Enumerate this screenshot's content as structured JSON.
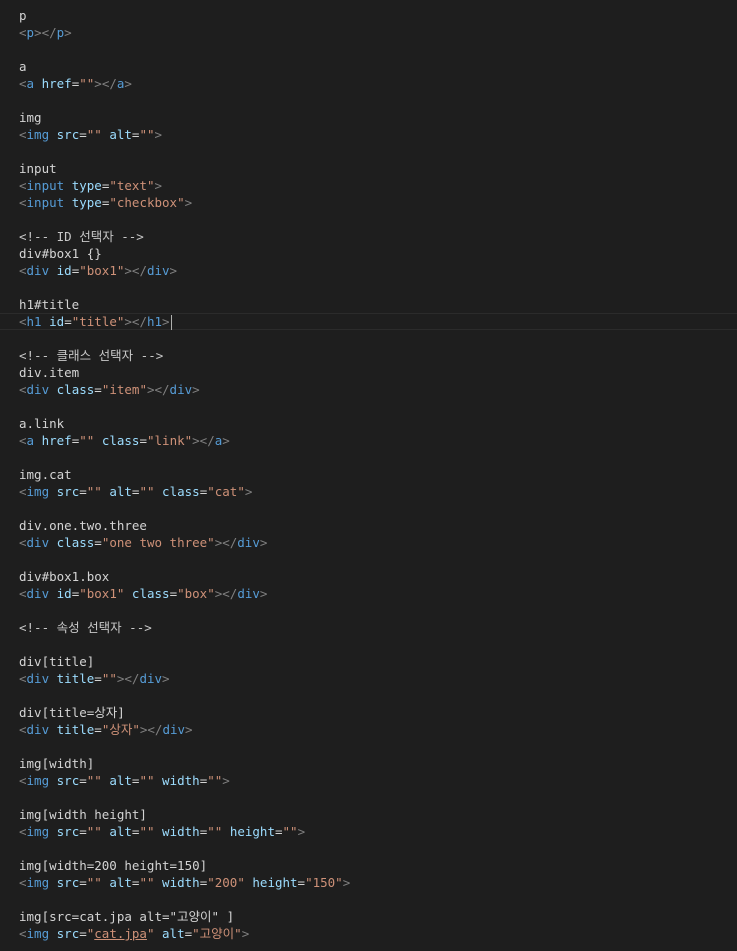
{
  "lines": [
    {
      "row": 0,
      "tokens": [
        {
          "t": "p",
          "c": "plain"
        }
      ]
    },
    {
      "row": 1,
      "tokens": [
        {
          "t": "<",
          "c": "punct"
        },
        {
          "t": "p",
          "c": "tag"
        },
        {
          "t": "></",
          "c": "punct"
        },
        {
          "t": "p",
          "c": "tag"
        },
        {
          "t": ">",
          "c": "punct"
        }
      ]
    },
    {
      "row": 3,
      "tokens": [
        {
          "t": "a",
          "c": "plain"
        }
      ]
    },
    {
      "row": 4,
      "tokens": [
        {
          "t": "<",
          "c": "punct"
        },
        {
          "t": "a",
          "c": "tag"
        },
        {
          "t": " ",
          "c": "plain"
        },
        {
          "t": "href",
          "c": "attr"
        },
        {
          "t": "=",
          "c": "op"
        },
        {
          "t": "\"\"",
          "c": "str"
        },
        {
          "t": "></",
          "c": "punct"
        },
        {
          "t": "a",
          "c": "tag"
        },
        {
          "t": ">",
          "c": "punct"
        }
      ]
    },
    {
      "row": 6,
      "tokens": [
        {
          "t": "img",
          "c": "plain"
        }
      ]
    },
    {
      "row": 7,
      "tokens": [
        {
          "t": "<",
          "c": "punct"
        },
        {
          "t": "img",
          "c": "tag"
        },
        {
          "t": " ",
          "c": "plain"
        },
        {
          "t": "src",
          "c": "attr"
        },
        {
          "t": "=",
          "c": "op"
        },
        {
          "t": "\"\"",
          "c": "str"
        },
        {
          "t": " ",
          "c": "plain"
        },
        {
          "t": "alt",
          "c": "attr"
        },
        {
          "t": "=",
          "c": "op"
        },
        {
          "t": "\"\"",
          "c": "str"
        },
        {
          "t": ">",
          "c": "punct"
        }
      ]
    },
    {
      "row": 9,
      "tokens": [
        {
          "t": "input",
          "c": "plain"
        }
      ]
    },
    {
      "row": 10,
      "tokens": [
        {
          "t": "<",
          "c": "punct"
        },
        {
          "t": "input",
          "c": "tag"
        },
        {
          "t": " ",
          "c": "plain"
        },
        {
          "t": "type",
          "c": "attr"
        },
        {
          "t": "=",
          "c": "op"
        },
        {
          "t": "\"text\"",
          "c": "str"
        },
        {
          "t": ">",
          "c": "punct"
        }
      ]
    },
    {
      "row": 11,
      "tokens": [
        {
          "t": "<",
          "c": "punct"
        },
        {
          "t": "input",
          "c": "tag"
        },
        {
          "t": " ",
          "c": "plain"
        },
        {
          "t": "type",
          "c": "attr"
        },
        {
          "t": "=",
          "c": "op"
        },
        {
          "t": "\"checkbox\"",
          "c": "str"
        },
        {
          "t": ">",
          "c": "punct"
        }
      ]
    },
    {
      "row": 13,
      "tokens": [
        {
          "t": "<!-- ID 선택자 -->",
          "c": "comment"
        }
      ]
    },
    {
      "row": 14,
      "tokens": [
        {
          "t": "div#box1 {}",
          "c": "plain"
        }
      ]
    },
    {
      "row": 15,
      "tokens": [
        {
          "t": "<",
          "c": "punct"
        },
        {
          "t": "div",
          "c": "tag"
        },
        {
          "t": " ",
          "c": "plain"
        },
        {
          "t": "id",
          "c": "attr"
        },
        {
          "t": "=",
          "c": "op"
        },
        {
          "t": "\"box1\"",
          "c": "str"
        },
        {
          "t": "></",
          "c": "punct"
        },
        {
          "t": "div",
          "c": "tag"
        },
        {
          "t": ">",
          "c": "punct"
        }
      ]
    },
    {
      "row": 17,
      "tokens": [
        {
          "t": "h1#title",
          "c": "plain"
        }
      ]
    },
    {
      "row": 18,
      "active": true,
      "cursor": true,
      "tokens": [
        {
          "t": "<",
          "c": "punct"
        },
        {
          "t": "h1",
          "c": "tag"
        },
        {
          "t": " ",
          "c": "plain"
        },
        {
          "t": "id",
          "c": "attr"
        },
        {
          "t": "=",
          "c": "op"
        },
        {
          "t": "\"title\"",
          "c": "str"
        },
        {
          "t": "></",
          "c": "punct"
        },
        {
          "t": "h1",
          "c": "tag"
        },
        {
          "t": ">",
          "c": "punct"
        }
      ]
    },
    {
      "row": 20,
      "tokens": [
        {
          "t": "<!-- 클래스 선택자 -->",
          "c": "comment"
        }
      ]
    },
    {
      "row": 21,
      "tokens": [
        {
          "t": "div.item",
          "c": "plain"
        }
      ]
    },
    {
      "row": 22,
      "tokens": [
        {
          "t": "<",
          "c": "punct"
        },
        {
          "t": "div",
          "c": "tag"
        },
        {
          "t": " ",
          "c": "plain"
        },
        {
          "t": "class",
          "c": "attr"
        },
        {
          "t": "=",
          "c": "op"
        },
        {
          "t": "\"item\"",
          "c": "str"
        },
        {
          "t": "></",
          "c": "punct"
        },
        {
          "t": "div",
          "c": "tag"
        },
        {
          "t": ">",
          "c": "punct"
        }
      ]
    },
    {
      "row": 24,
      "tokens": [
        {
          "t": "a.link",
          "c": "plain"
        }
      ]
    },
    {
      "row": 25,
      "tokens": [
        {
          "t": "<",
          "c": "punct"
        },
        {
          "t": "a",
          "c": "tag"
        },
        {
          "t": " ",
          "c": "plain"
        },
        {
          "t": "href",
          "c": "attr"
        },
        {
          "t": "=",
          "c": "op"
        },
        {
          "t": "\"\"",
          "c": "str"
        },
        {
          "t": " ",
          "c": "plain"
        },
        {
          "t": "class",
          "c": "attr"
        },
        {
          "t": "=",
          "c": "op"
        },
        {
          "t": "\"link\"",
          "c": "str"
        },
        {
          "t": "></",
          "c": "punct"
        },
        {
          "t": "a",
          "c": "tag"
        },
        {
          "t": ">",
          "c": "punct"
        }
      ]
    },
    {
      "row": 27,
      "tokens": [
        {
          "t": "img.cat",
          "c": "plain"
        }
      ]
    },
    {
      "row": 28,
      "tokens": [
        {
          "t": "<",
          "c": "punct"
        },
        {
          "t": "img",
          "c": "tag"
        },
        {
          "t": " ",
          "c": "plain"
        },
        {
          "t": "src",
          "c": "attr"
        },
        {
          "t": "=",
          "c": "op"
        },
        {
          "t": "\"\"",
          "c": "str"
        },
        {
          "t": " ",
          "c": "plain"
        },
        {
          "t": "alt",
          "c": "attr"
        },
        {
          "t": "=",
          "c": "op"
        },
        {
          "t": "\"\"",
          "c": "str"
        },
        {
          "t": " ",
          "c": "plain"
        },
        {
          "t": "class",
          "c": "attr"
        },
        {
          "t": "=",
          "c": "op"
        },
        {
          "t": "\"cat\"",
          "c": "str"
        },
        {
          "t": ">",
          "c": "punct"
        }
      ]
    },
    {
      "row": 30,
      "tokens": [
        {
          "t": "div.one.two.three",
          "c": "plain"
        }
      ]
    },
    {
      "row": 31,
      "tokens": [
        {
          "t": "<",
          "c": "punct"
        },
        {
          "t": "div",
          "c": "tag"
        },
        {
          "t": " ",
          "c": "plain"
        },
        {
          "t": "class",
          "c": "attr"
        },
        {
          "t": "=",
          "c": "op"
        },
        {
          "t": "\"one two three\"",
          "c": "str"
        },
        {
          "t": "></",
          "c": "punct"
        },
        {
          "t": "div",
          "c": "tag"
        },
        {
          "t": ">",
          "c": "punct"
        }
      ]
    },
    {
      "row": 33,
      "tokens": [
        {
          "t": "div#box1.box",
          "c": "plain"
        }
      ]
    },
    {
      "row": 34,
      "tokens": [
        {
          "t": "<",
          "c": "punct"
        },
        {
          "t": "div",
          "c": "tag"
        },
        {
          "t": " ",
          "c": "plain"
        },
        {
          "t": "id",
          "c": "attr"
        },
        {
          "t": "=",
          "c": "op"
        },
        {
          "t": "\"box1\"",
          "c": "str"
        },
        {
          "t": " ",
          "c": "plain"
        },
        {
          "t": "class",
          "c": "attr"
        },
        {
          "t": "=",
          "c": "op"
        },
        {
          "t": "\"box\"",
          "c": "str"
        },
        {
          "t": "></",
          "c": "punct"
        },
        {
          "t": "div",
          "c": "tag"
        },
        {
          "t": ">",
          "c": "punct"
        }
      ]
    },
    {
      "row": 36,
      "tokens": [
        {
          "t": "<!-- 속성 선택자 -->",
          "c": "comment"
        }
      ]
    },
    {
      "row": 38,
      "tokens": [
        {
          "t": "div[title]",
          "c": "plain"
        }
      ]
    },
    {
      "row": 39,
      "tokens": [
        {
          "t": "<",
          "c": "punct"
        },
        {
          "t": "div",
          "c": "tag"
        },
        {
          "t": " ",
          "c": "plain"
        },
        {
          "t": "title",
          "c": "attr"
        },
        {
          "t": "=",
          "c": "op"
        },
        {
          "t": "\"\"",
          "c": "str"
        },
        {
          "t": "></",
          "c": "punct"
        },
        {
          "t": "div",
          "c": "tag"
        },
        {
          "t": ">",
          "c": "punct"
        }
      ]
    },
    {
      "row": 41,
      "tokens": [
        {
          "t": "div[title=상자]",
          "c": "plain"
        }
      ]
    },
    {
      "row": 42,
      "tokens": [
        {
          "t": "<",
          "c": "punct"
        },
        {
          "t": "div",
          "c": "tag"
        },
        {
          "t": " ",
          "c": "plain"
        },
        {
          "t": "title",
          "c": "attr"
        },
        {
          "t": "=",
          "c": "op"
        },
        {
          "t": "\"상자\"",
          "c": "str"
        },
        {
          "t": "></",
          "c": "punct"
        },
        {
          "t": "div",
          "c": "tag"
        },
        {
          "t": ">",
          "c": "punct"
        }
      ]
    },
    {
      "row": 44,
      "tokens": [
        {
          "t": "img[width]",
          "c": "plain"
        }
      ]
    },
    {
      "row": 45,
      "tokens": [
        {
          "t": "<",
          "c": "punct"
        },
        {
          "t": "img",
          "c": "tag"
        },
        {
          "t": " ",
          "c": "plain"
        },
        {
          "t": "src",
          "c": "attr"
        },
        {
          "t": "=",
          "c": "op"
        },
        {
          "t": "\"\"",
          "c": "str"
        },
        {
          "t": " ",
          "c": "plain"
        },
        {
          "t": "alt",
          "c": "attr"
        },
        {
          "t": "=",
          "c": "op"
        },
        {
          "t": "\"\"",
          "c": "str"
        },
        {
          "t": " ",
          "c": "plain"
        },
        {
          "t": "width",
          "c": "attr"
        },
        {
          "t": "=",
          "c": "op"
        },
        {
          "t": "\"\"",
          "c": "str"
        },
        {
          "t": ">",
          "c": "punct"
        }
      ]
    },
    {
      "row": 47,
      "tokens": [
        {
          "t": "img[width height]",
          "c": "plain"
        }
      ]
    },
    {
      "row": 48,
      "tokens": [
        {
          "t": "<",
          "c": "punct"
        },
        {
          "t": "img",
          "c": "tag"
        },
        {
          "t": " ",
          "c": "plain"
        },
        {
          "t": "src",
          "c": "attr"
        },
        {
          "t": "=",
          "c": "op"
        },
        {
          "t": "\"\"",
          "c": "str"
        },
        {
          "t": " ",
          "c": "plain"
        },
        {
          "t": "alt",
          "c": "attr"
        },
        {
          "t": "=",
          "c": "op"
        },
        {
          "t": "\"\"",
          "c": "str"
        },
        {
          "t": " ",
          "c": "plain"
        },
        {
          "t": "width",
          "c": "attr"
        },
        {
          "t": "=",
          "c": "op"
        },
        {
          "t": "\"\"",
          "c": "str"
        },
        {
          "t": " ",
          "c": "plain"
        },
        {
          "t": "height",
          "c": "attr"
        },
        {
          "t": "=",
          "c": "op"
        },
        {
          "t": "\"\"",
          "c": "str"
        },
        {
          "t": ">",
          "c": "punct"
        }
      ]
    },
    {
      "row": 50,
      "tokens": [
        {
          "t": "img[width=200 height=150]",
          "c": "plain"
        }
      ]
    },
    {
      "row": 51,
      "tokens": [
        {
          "t": "<",
          "c": "punct"
        },
        {
          "t": "img",
          "c": "tag"
        },
        {
          "t": " ",
          "c": "plain"
        },
        {
          "t": "src",
          "c": "attr"
        },
        {
          "t": "=",
          "c": "op"
        },
        {
          "t": "\"\"",
          "c": "str"
        },
        {
          "t": " ",
          "c": "plain"
        },
        {
          "t": "alt",
          "c": "attr"
        },
        {
          "t": "=",
          "c": "op"
        },
        {
          "t": "\"\"",
          "c": "str"
        },
        {
          "t": " ",
          "c": "plain"
        },
        {
          "t": "width",
          "c": "attr"
        },
        {
          "t": "=",
          "c": "op"
        },
        {
          "t": "\"200\"",
          "c": "str"
        },
        {
          "t": " ",
          "c": "plain"
        },
        {
          "t": "height",
          "c": "attr"
        },
        {
          "t": "=",
          "c": "op"
        },
        {
          "t": "\"150\"",
          "c": "str"
        },
        {
          "t": ">",
          "c": "punct"
        }
      ]
    },
    {
      "row": 53,
      "tokens": [
        {
          "t": "img[src=cat.jpa alt=\"고양이\" ]",
          "c": "plain"
        }
      ]
    },
    {
      "row": 54,
      "tokens": [
        {
          "t": "<",
          "c": "punct"
        },
        {
          "t": "img",
          "c": "tag"
        },
        {
          "t": " ",
          "c": "plain"
        },
        {
          "t": "src",
          "c": "attr"
        },
        {
          "t": "=",
          "c": "op"
        },
        {
          "t": "\"",
          "c": "str"
        },
        {
          "t": "cat.jpa",
          "c": "strlink"
        },
        {
          "t": "\"",
          "c": "str"
        },
        {
          "t": " ",
          "c": "plain"
        },
        {
          "t": "alt",
          "c": "attr"
        },
        {
          "t": "=",
          "c": "op"
        },
        {
          "t": "\"고양이\"",
          "c": "str"
        },
        {
          "t": ">",
          "c": "punct"
        }
      ]
    }
  ]
}
